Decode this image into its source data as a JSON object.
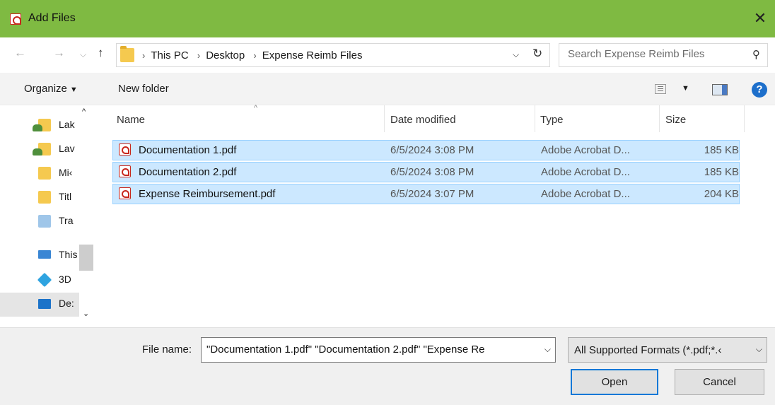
{
  "window": {
    "title": "Add Files",
    "close_glyph": "✕"
  },
  "nav": {
    "back_glyph": "←",
    "forward_glyph": "→",
    "recent_glyph": "⌵",
    "up_glyph": "↑",
    "breadcrumb": [
      "This PC",
      "Desktop",
      "Expense Reimb Files"
    ],
    "breadcrumb_sep": "›",
    "dropdown_glyph": "⌵",
    "refresh_glyph": "↻"
  },
  "search": {
    "placeholder": "Search Expense Reimb Files",
    "icon_glyph": "⚲"
  },
  "toolbar": {
    "organize_label": "Organize",
    "organize_caret": "▼",
    "new_folder_label": "New folder",
    "view_caret": "▼",
    "help_label": "?"
  },
  "sidebar": {
    "scroll_up": "^",
    "scroll_down": "⌄",
    "items": [
      {
        "label": "Lak",
        "icon": "shared-folder-icon"
      },
      {
        "label": "Lav",
        "icon": "shared-folder-icon"
      },
      {
        "label": "Mi‹",
        "icon": "folder-icon"
      },
      {
        "label": "Titl",
        "icon": "folder-icon"
      },
      {
        "label": "Tra",
        "icon": "network-folder-icon"
      },
      {
        "label": "This",
        "icon": "this-pc-icon"
      },
      {
        "label": "3D",
        "icon": "3d-objects-icon"
      },
      {
        "label": "De:",
        "icon": "desktop-icon",
        "selected": true
      }
    ]
  },
  "file_list": {
    "sort_indicator": "^",
    "columns": [
      "Name",
      "Date modified",
      "Type",
      "Size"
    ],
    "rows": [
      {
        "name": "Documentation 1.pdf",
        "date": "6/5/2024 3:08 PM",
        "type": "Adobe Acrobat D...",
        "size": "185 KB"
      },
      {
        "name": "Documentation 2.pdf",
        "date": "6/5/2024 3:08 PM",
        "type": "Adobe Acrobat D...",
        "size": "185 KB"
      },
      {
        "name": "Expense Reimbursement.pdf",
        "date": "6/5/2024 3:07 PM",
        "type": "Adobe Acrobat D...",
        "size": "204 KB"
      }
    ]
  },
  "footer": {
    "file_name_label": "File name:",
    "file_name_value": "\"Documentation 1.pdf\" \"Documentation 2.pdf\" \"Expense Re",
    "dropdown_glyph": "⌵",
    "filter_value": "All Supported Formats (*.pdf;*.‹",
    "open_label": "Open",
    "cancel_label": "Cancel"
  },
  "colors": {
    "title_bar": "#7fba42",
    "selection_fill": "#cce8ff",
    "selection_border": "#99d1ff",
    "pdf_red": "#c8281e",
    "default_button_border": "#0078d7"
  }
}
